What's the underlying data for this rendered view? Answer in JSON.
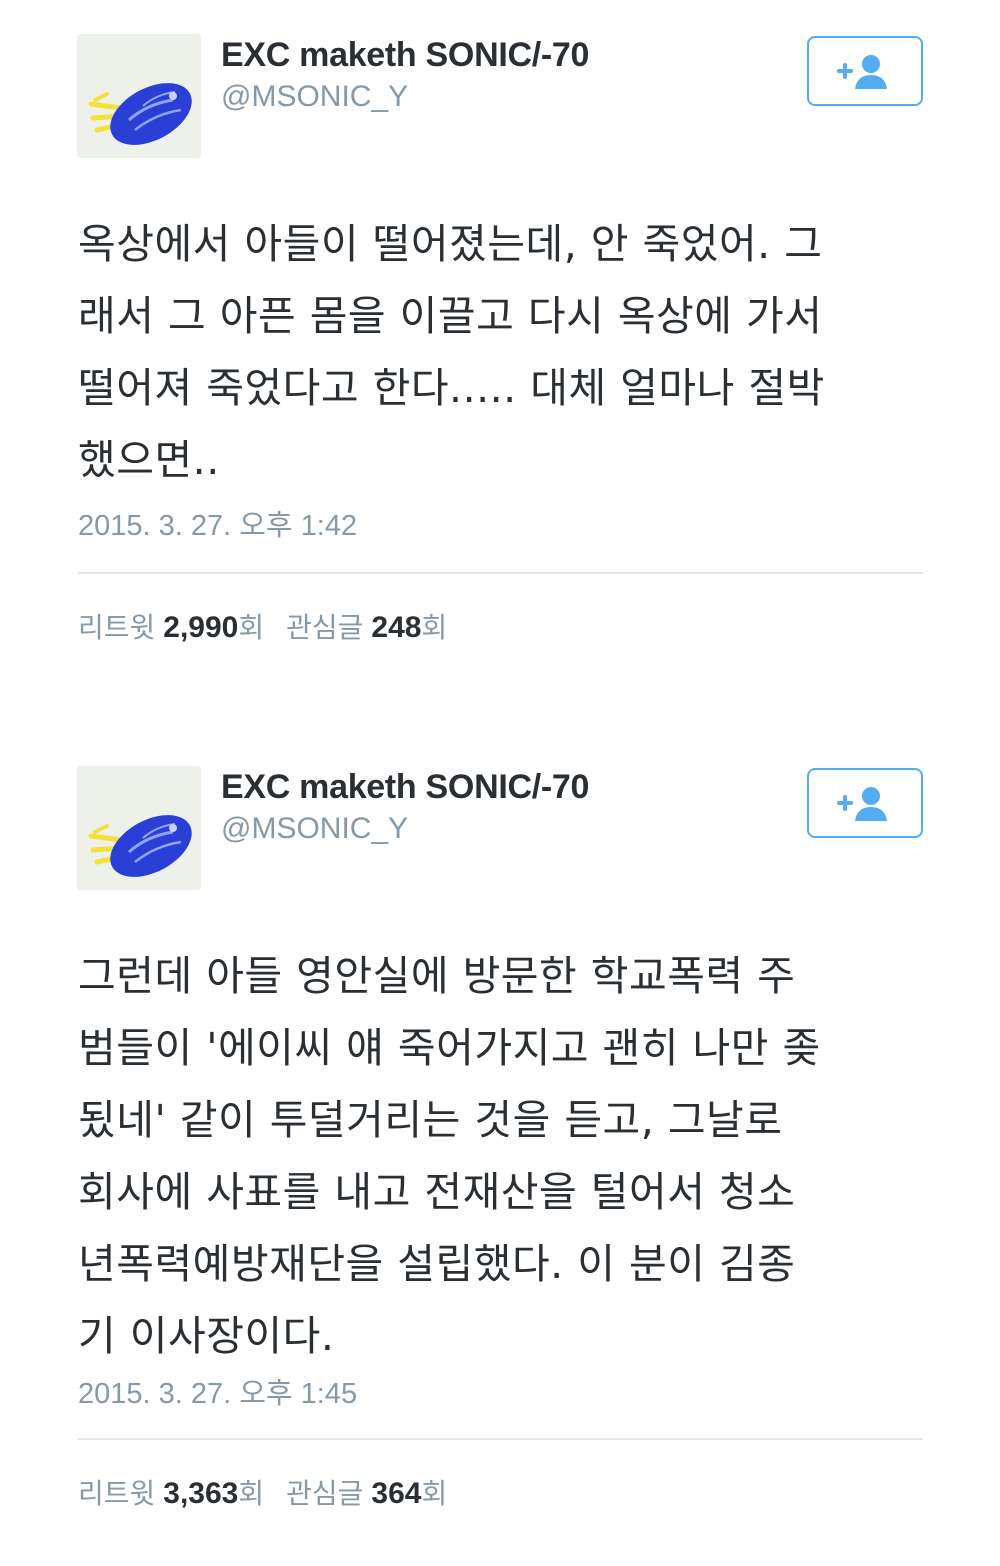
{
  "tweets": [
    {
      "display_name": "EXC maketh SONIC/-70",
      "handle": "@MSONIC_Y",
      "text": "옥상에서 아들이 떨어졌는데, 안 죽었어. 그\n래서 그 아픈 몸을 이끌고 다시 옥상에 가서\n떨어져 죽었다고 한다..... 대체 얼마나 절박\n했으면..",
      "timestamp": "2015. 3. 27. 오후 1:42",
      "retweet_label": "리트윗",
      "retweet_count": "2,990",
      "retweet_unit": "회",
      "like_label": "관심글",
      "like_count": "248",
      "like_unit": "회"
    },
    {
      "display_name": "EXC maketh SONIC/-70",
      "handle": "@MSONIC_Y",
      "text": "그런데 아들 영안실에 방문한 학교폭력 주\n범들이 '에이씨 얘 죽어가지고 괜히 나만 좆\n됬네' 같이 투덜거리는 것을 듣고, 그날로\n회사에 사표를 내고 전재산을 털어서 청소\n년폭력예방재단을 설립했다. 이 분이 김종\n기 이사장이다.",
      "timestamp": "2015. 3. 27. 오후 1:45",
      "retweet_label": "리트윗",
      "retweet_count": "3,363",
      "retweet_unit": "회",
      "like_label": "관심글",
      "like_count": "364",
      "like_unit": "회"
    }
  ],
  "icons": {
    "avatar": "blue-rocket-sonic-avatar",
    "follow": "follow-add-user-icon"
  },
  "colors": {
    "accent": "#55acee",
    "muted_text": "#8899a6",
    "main_text": "#292f33",
    "divider": "#e1e8ed",
    "avatar_blue": "#2a3fd6",
    "avatar_yellow": "#f2e23a"
  }
}
